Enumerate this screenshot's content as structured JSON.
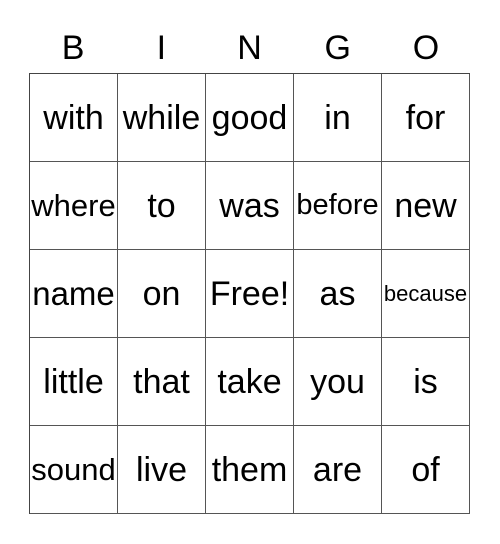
{
  "header": [
    "B",
    "I",
    "N",
    "G",
    "O"
  ],
  "grid": [
    [
      "with",
      "while",
      "good",
      "in",
      "for"
    ],
    [
      "where",
      "to",
      "was",
      "before",
      "new"
    ],
    [
      "name",
      "on",
      "Free!",
      "as",
      "because"
    ],
    [
      "little",
      "that",
      "take",
      "you",
      "is"
    ],
    [
      "sound",
      "live",
      "them",
      "are",
      "of"
    ]
  ]
}
